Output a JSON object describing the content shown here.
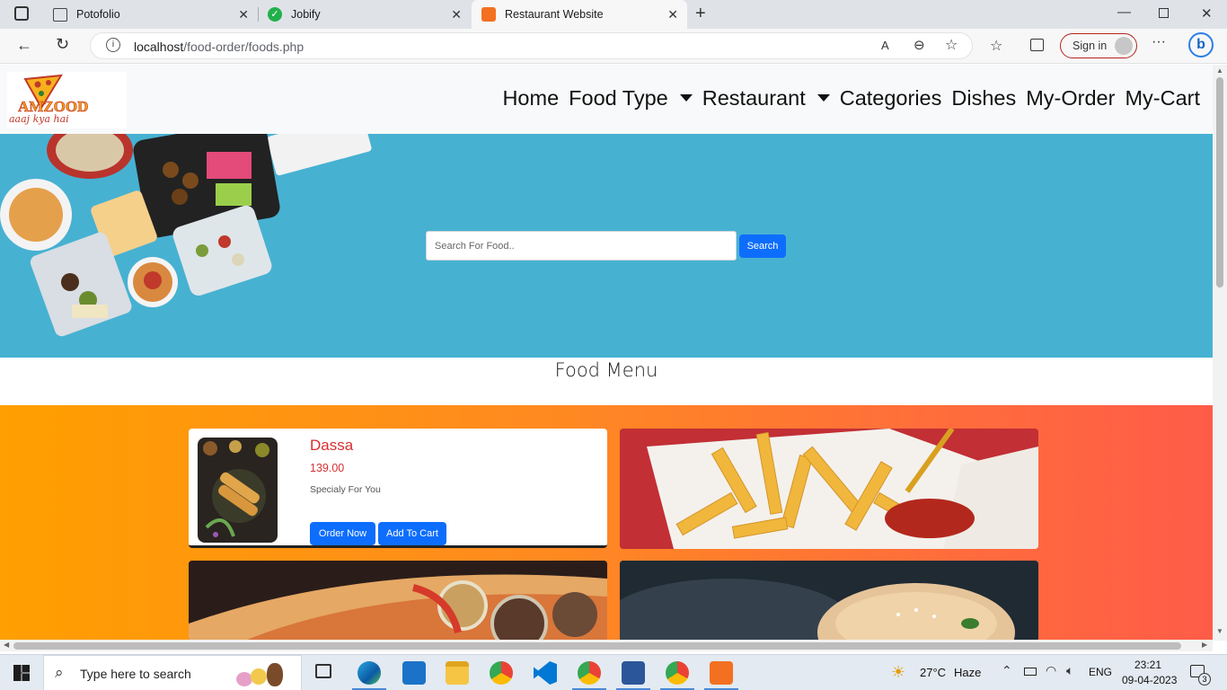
{
  "browser": {
    "tabs": [
      {
        "title": "Potofolio"
      },
      {
        "title": "Jobify"
      },
      {
        "title": "Restaurant Website"
      }
    ],
    "url_host": "localhost",
    "url_path": "/food-order/foods.php",
    "sign_in": "Sign in"
  },
  "site": {
    "logo_text": "AMZOOD",
    "logo_tagline": "aaaj kya hai",
    "nav": [
      {
        "label": "Home"
      },
      {
        "label": "Food Type"
      },
      {
        "label": "Restaurant"
      },
      {
        "label": "Categories"
      },
      {
        "label": "Dishes"
      },
      {
        "label": "My-Order"
      },
      {
        "label": "My-Cart"
      }
    ],
    "search_placeholder": "Search For Food..",
    "search_button": "Search",
    "section_title": "Food Menu",
    "foods": [
      {
        "name": "Dassa",
        "price": "139.00",
        "description": "Specialy For You",
        "order_button": "Order Now",
        "cart_button": "Add To Cart"
      }
    ]
  },
  "taskbar": {
    "search_placeholder": "Type here to search",
    "weather_temp": "27°C",
    "weather_desc": "Haze",
    "language": "ENG",
    "time": "23:21",
    "date": "09-04-2023",
    "notifications": "3"
  },
  "colors": {
    "hero_bg": "#47b1d2",
    "accent_button": "#0d6efd",
    "price_color": "#d63031"
  }
}
